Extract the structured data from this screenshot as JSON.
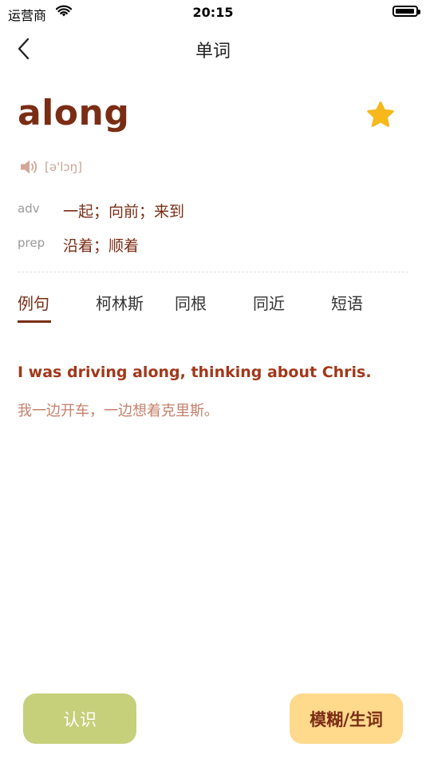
{
  "status_bar": {
    "carrier": "运营商",
    "time": "20:15",
    "icons": [
      "wifi-icon",
      "battery-icon"
    ]
  },
  "nav": {
    "title": "单词",
    "back_icon": "chevron-left-icon"
  },
  "word": {
    "text": "along",
    "phonetic": "[ə'lɔŋ]",
    "favorite_icon": "star-icon",
    "audio_icon": "speaker-icon",
    "definitions": [
      {
        "pos": "adv",
        "meaning": "一起；向前；来到"
      },
      {
        "pos": "prep",
        "meaning": "沿着；顺着"
      }
    ]
  },
  "tabs": [
    {
      "label": "例句",
      "active": true
    },
    {
      "label": "柯林斯",
      "active": false
    },
    {
      "label": "同根",
      "active": false
    },
    {
      "label": "同近",
      "active": false
    },
    {
      "label": "短语",
      "active": false
    }
  ],
  "example": {
    "en": "I was driving along, thinking about Chris.",
    "cn": "我一边开车，一边想着克里斯。"
  },
  "actions": {
    "known_label": "认识",
    "unknown_label": "模糊/生词"
  },
  "colors": {
    "accent": "#7a2d14",
    "star": "#f6b81c",
    "known_button": "#c6cf7a",
    "unknown_button": "#ffd98c"
  }
}
